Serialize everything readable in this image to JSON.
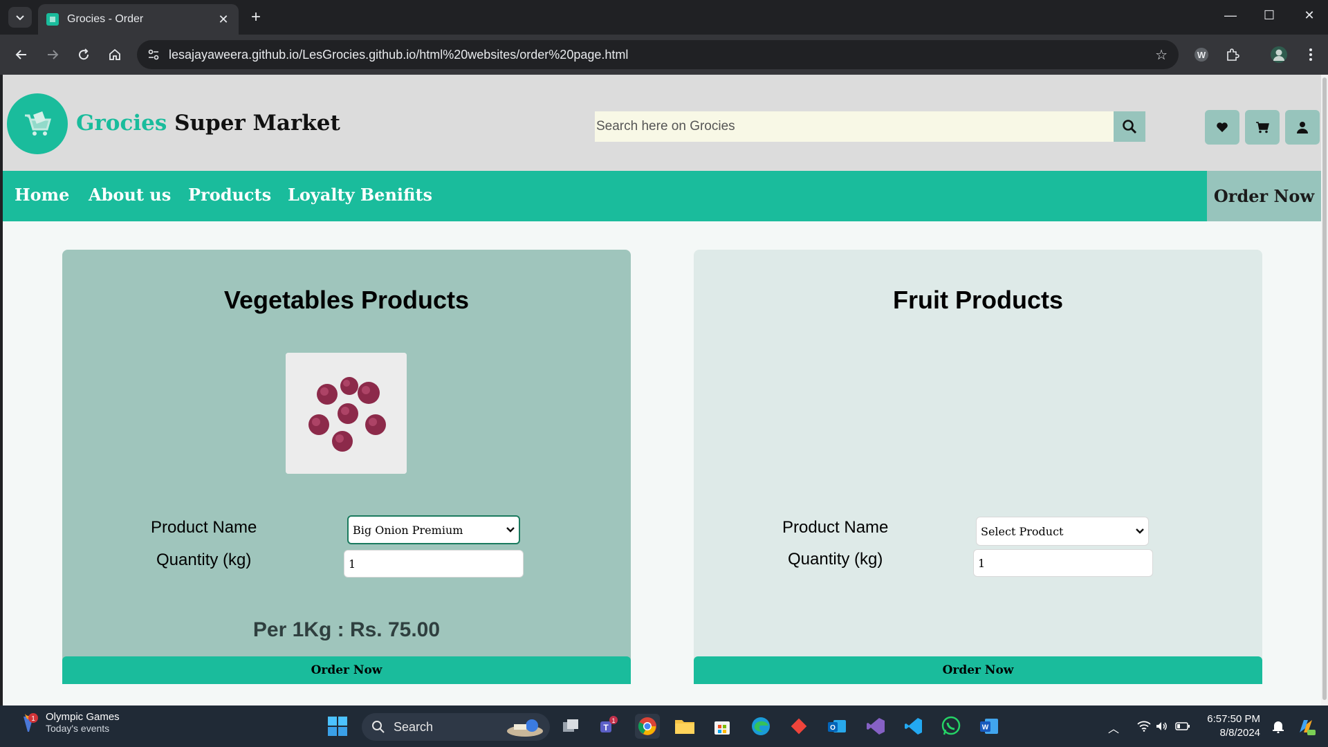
{
  "browser": {
    "tab_title": "Grocies - Order",
    "url": "lesajayaweera.github.io/LesGrocies.github.io/html%20websites/order%20page.html"
  },
  "header": {
    "brand_green": "Grocies",
    "brand_black": "Super Market",
    "search_placeholder": "Search here on Grocies"
  },
  "nav": {
    "items": [
      "Home",
      "About us",
      "Products",
      "Loyalty Benifits"
    ],
    "order_now": "Order Now"
  },
  "vegetables": {
    "title": "Vegetables Products",
    "product_label": "Product Name",
    "product_value": "Big Onion Premium",
    "quantity_label": "Quantity (kg)",
    "quantity_value": "1",
    "price": "Per 1Kg : Rs. 75.00",
    "order_button": "Order Now"
  },
  "fruits": {
    "title": "Fruit Products",
    "product_label": "Product Name",
    "product_value": "Select Product",
    "quantity_label": "Quantity (kg)",
    "quantity_value": "1",
    "order_button": "Order Now"
  },
  "taskbar": {
    "weather_title": "Olympic Games",
    "weather_sub": "Today's events",
    "weather_badge": "1",
    "search_label": "Search",
    "teams_badge": "1",
    "time": "6:57:50 PM",
    "date": "8/8/2024"
  },
  "colors": {
    "brand": "#1abc9c",
    "accent_muted": "#97c4bc",
    "veg_card": "#9fc5bc",
    "fruit_card": "#deeae8"
  }
}
